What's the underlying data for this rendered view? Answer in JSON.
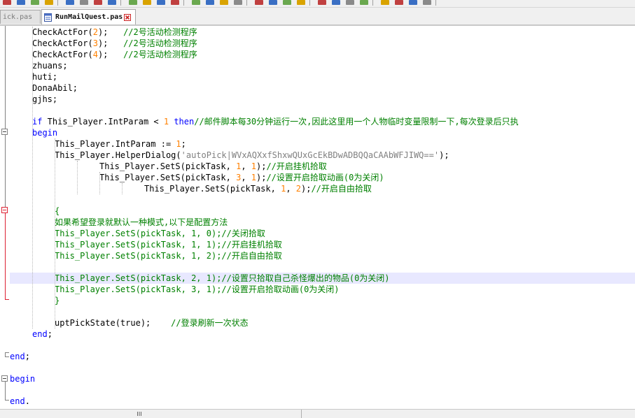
{
  "tabs": [
    {
      "label": "ick.pas",
      "active": false
    },
    {
      "label": "RunMailQuest.pas",
      "active": true
    }
  ],
  "code_lines": [
    "CheckActFor(2);   //2号活动检测程序",
    "CheckActFor(3);   //2号活动检测程序",
    "CheckActFor(4);   //2号活动检测程序",
    "zhuans;",
    "huti;",
    "DonaAbil;",
    "gjhs;",
    "",
    "if This_Player.IntParam < 1 then//邮件脚本每30分钟运行一次,因此这里用一个人物临时变量限制一下,每次登录后只执",
    "begin",
    "This_Player.IntParam := 1;",
    "This_Player.HelperDialog('autoPick|WVxAQXxfShxwQUxGcEkBDwADBQQaCAAbWFJIWQ==');",
    "This_Player.SetS(pickTask, 1, 1);//开启挂机拾取",
    "This_Player.SetS(pickTask, 3, 1);//设置开启拾取动画(0为关闭)",
    "This_Player.SetS(pickTask, 1, 2);//开启自由拾取",
    "",
    "{",
    "如果希望登录就默认一种模式,以下是配置方法",
    "This_Player.SetS(pickTask, 1, 0);//关闭拾取",
    "This_Player.SetS(pickTask, 1, 1);//开启挂机拾取",
    "This_Player.SetS(pickTask, 1, 2);//开启自由拾取",
    "",
    "This_Player.SetS(pickTask, 2, 1);//设置只拾取自己杀怪爆出的物品(0为关闭)",
    "This_Player.SetS(pickTask, 3, 1);//设置开启拾取动画(0为关闭)",
    "}",
    "",
    "uptPickState(true);    //登录刷新一次状态",
    "end;",
    "",
    "end;",
    "",
    "begin",
    "",
    "end."
  ],
  "colors": {
    "keyword": "#0000ff",
    "number": "#ff8000",
    "comment": "#008000",
    "string": "#808080",
    "current_line": "#e8e8ff"
  },
  "icons": [
    "file-icon",
    "close-tab-icon",
    "fold-minus-icon",
    "scroll-grip-icon"
  ]
}
